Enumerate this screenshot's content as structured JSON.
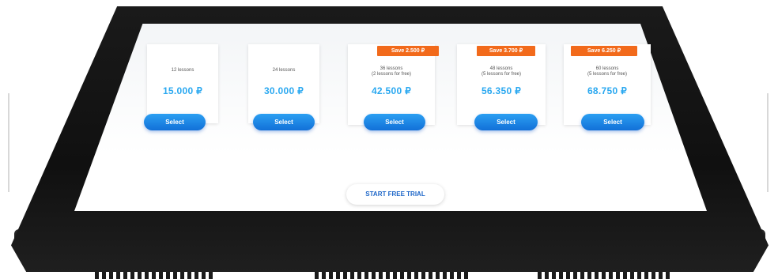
{
  "plans": [
    {
      "lessons": "12 lessons",
      "price": "15.000 ₽",
      "badge": "",
      "button": "Select"
    },
    {
      "lessons": "24 lessons",
      "price": "30.000 ₽",
      "badge": "",
      "button": "Select"
    },
    {
      "lessons": "36 lessons\n(2 lessons for free)",
      "price": "42.500 ₽",
      "badge": "Save 2.500 ₽",
      "button": "Select"
    },
    {
      "lessons": "48 lessons\n(5 lessons for free)",
      "price": "56.350 ₽",
      "badge": "Save 3.700 ₽",
      "button": "Select"
    },
    {
      "lessons": "60 lessons\n(5 lessons for free)",
      "price": "68.750 ₽",
      "badge": "Save 6.250 ₽",
      "button": "Select"
    }
  ],
  "trial_button": "START FREE TRIAL"
}
